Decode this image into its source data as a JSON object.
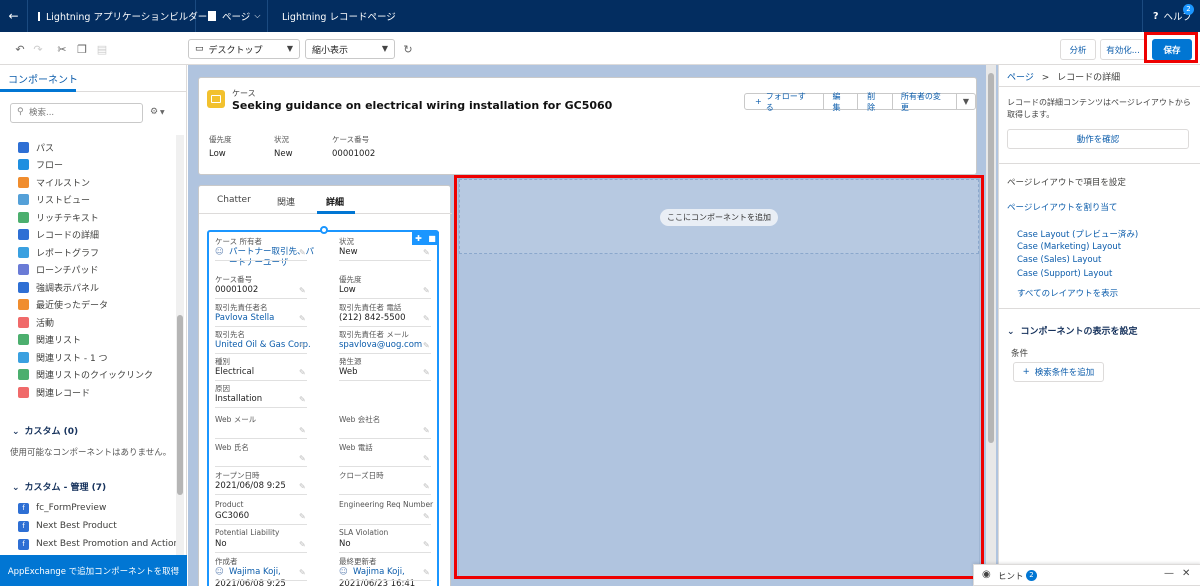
{
  "topbar": {
    "back_icon": "back-arrow-icon",
    "app_builder": "Lightning アプリケーションビルダー",
    "page_menu": "ページ",
    "page_type": "Lightning レコードページ",
    "help": "ヘルプ",
    "help_badge": "2"
  },
  "toolbar": {
    "device_select": "デスクトップ",
    "view_select": "縮小表示",
    "analyze": "分析",
    "activate": "有効化...",
    "save": "保存"
  },
  "left": {
    "tab": "コンポーネント",
    "search_placeholder": "検索...",
    "standard": [
      {
        "label": "パス",
        "color": "#2e6fd4",
        "icon": "path-icon"
      },
      {
        "label": "フロー",
        "color": "#1f8fe0",
        "icon": "flow-icon"
      },
      {
        "label": "マイルストン",
        "color": "#f08d2e",
        "icon": "milestone-icon"
      },
      {
        "label": "リストビュー",
        "color": "#54a0d8",
        "icon": "list-view-icon"
      },
      {
        "label": "リッチテキスト",
        "color": "#4caf6e",
        "icon": "rich-text-icon"
      },
      {
        "label": "レコードの詳細",
        "color": "#2e6fd4",
        "icon": "record-detail-icon"
      },
      {
        "label": "レポートグラフ",
        "color": "#3aa0e0",
        "icon": "report-chart-icon"
      },
      {
        "label": "ローンチパッド",
        "color": "#6a7bd6",
        "icon": "launchpad-icon"
      },
      {
        "label": "強調表示パネル",
        "color": "#2e6fd4",
        "icon": "highlight-panel-icon"
      },
      {
        "label": "最近使ったデータ",
        "color": "#f08d2e",
        "icon": "recent-items-icon"
      },
      {
        "label": "活動",
        "color": "#f06a6a",
        "icon": "activity-icon"
      },
      {
        "label": "関連リスト",
        "color": "#4caf6e",
        "icon": "related-list-icon"
      },
      {
        "label": "関連リスト - 1 つ",
        "color": "#3aa0e0",
        "icon": "related-list-single-icon"
      },
      {
        "label": "関連リストのクイックリンク",
        "color": "#4caf6e",
        "icon": "related-quick-links-icon"
      },
      {
        "label": "関連レコード",
        "color": "#f06a6a",
        "icon": "related-record-icon"
      }
    ],
    "custom_header": "カスタム (0)",
    "custom_empty": "使用可能なコンポーネントはありません。",
    "managed_header": "カスタム - 管理 (7)",
    "managed": [
      "fc_FormPreview",
      "Next Best Product",
      "Next Best Promotion and Action"
    ],
    "appexchange": "AppExchange で追加コンポーネントを取得"
  },
  "record": {
    "object": "ケース",
    "title": "Seeking guidance on electrical wiring installation for GC5060",
    "actions": [
      "フォローする",
      "編集",
      "削除",
      "所有者の変更"
    ],
    "highlights": [
      {
        "label": "優先度",
        "value": "Low"
      },
      {
        "label": "状況",
        "value": "New"
      },
      {
        "label": "ケース番号",
        "value": "00001002"
      }
    ],
    "tabs": [
      "Chatter",
      "関連",
      "詳細"
    ],
    "active_tab": "詳細",
    "fields_left": [
      {
        "label": "ケース 所有者",
        "value": "パートナー取引先、パートナーユーザ",
        "link": true,
        "avatar": true
      },
      {
        "label": "ケース番号",
        "value": "00001002"
      },
      {
        "label": "取引先責任者名",
        "value": "Pavlova Stella",
        "link": true
      },
      {
        "label": "取引先名",
        "value": "United Oil & Gas Corp.",
        "link": true
      },
      {
        "label": "種別",
        "value": "Electrical"
      },
      {
        "label": "原因",
        "value": "Installation"
      },
      {
        "label": "Web メール",
        "value": ""
      },
      {
        "label": "Web 氏名",
        "value": ""
      },
      {
        "label": "オープン日時",
        "value": "2021/06/08 9:25"
      },
      {
        "label": "Product",
        "value": "GC3060"
      },
      {
        "label": "Potential Liability",
        "value": "No"
      },
      {
        "label": "作成者",
        "value": "Wajima Koji,",
        "sub": "2021/06/08 9:25",
        "link": true,
        "avatar": true
      }
    ],
    "fields_right": [
      {
        "label": "状況",
        "value": "New"
      },
      {
        "label": "優先度",
        "value": "Low"
      },
      {
        "label": "取引先責任者 電話",
        "value": "(212) 842-5500"
      },
      {
        "label": "取引先責任者 メール",
        "value": "spavlova@uog.com",
        "link": true
      },
      {
        "label": "発生源",
        "value": "Web"
      },
      {
        "label": "",
        "value": ""
      },
      {
        "label": "Web 会社名",
        "value": ""
      },
      {
        "label": "Web 電話",
        "value": ""
      },
      {
        "label": "クローズ日時",
        "value": ""
      },
      {
        "label": "Engineering Req Number",
        "value": ""
      },
      {
        "label": "SLA Violation",
        "value": "No"
      },
      {
        "label": "最終更新者",
        "value": "Wajima Koji,",
        "sub": "2021/06/23 16:41",
        "link": true,
        "avatar": true
      }
    ],
    "add_component": "ここにコンポーネントを追加"
  },
  "right": {
    "breadcrumb_page": "ページ",
    "breadcrumb_sep": ">",
    "breadcrumb_current": "レコードの詳細",
    "description": "レコードの詳細コンテンツはページレイアウトから取得します。",
    "confirm_button": "動作を確認",
    "set_fields": "ページレイアウトで項目を設定",
    "assign_layout": "ページレイアウトを割り当て",
    "layouts": [
      "Case Layout (プレビュー済み)",
      "Case (Marketing) Layout",
      "Case (Sales) Layout",
      "Case (Support) Layout"
    ],
    "view_all": "すべてのレイアウトを表示",
    "visibility_header": "コンポーネントの表示を設定",
    "filter_label": "条件",
    "add_filter": "検索条件を追加",
    "hint": "ヒント",
    "hint_badge": "2"
  },
  "colors": {
    "brand": "#032d60",
    "accent": "#0176d3",
    "highlight_border": "#e00000"
  }
}
